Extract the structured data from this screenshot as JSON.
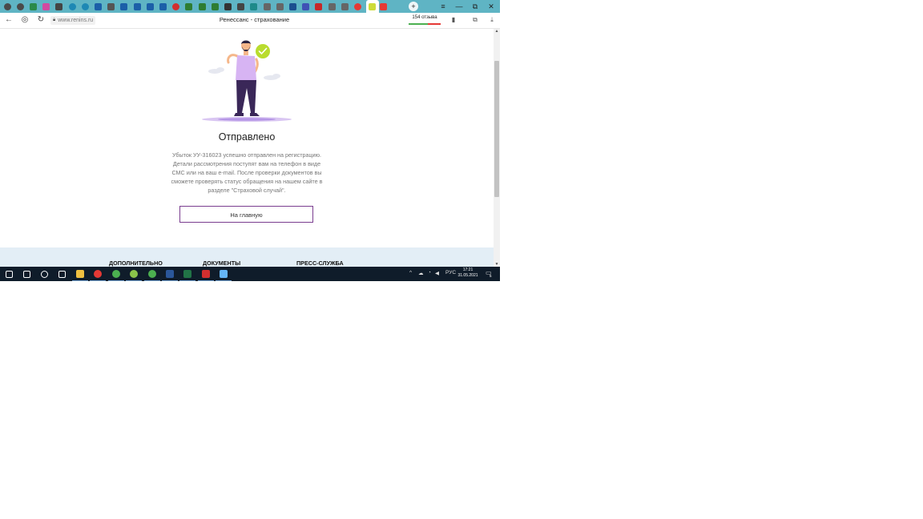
{
  "browser": {
    "url": "www.renins.ru",
    "page_title": "Ренессанс - страхование",
    "reviews_badge": "154 отзыва",
    "window_controls": {
      "menu": "≡",
      "minimize": "—",
      "restore": "⧉",
      "close": "✕"
    },
    "new_tab": "+"
  },
  "tabs": [
    {
      "icon": "opera-icon",
      "color": "#4a4a4a"
    },
    {
      "icon": "opera-icon",
      "color": "#4a4a4a"
    },
    {
      "icon": "vk-icon",
      "color": "#2a8a4a"
    },
    {
      "icon": "pinterest-icon",
      "color": "#d24aa0"
    },
    {
      "icon": "document-icon",
      "color": "#444"
    },
    {
      "icon": "circle-icon",
      "color": "#1e88b4"
    },
    {
      "icon": "circle-icon",
      "color": "#1e88b4"
    },
    {
      "icon": "monitor-icon",
      "color": "#1b5fa8"
    },
    {
      "icon": "tag-icon",
      "color": "#555"
    },
    {
      "icon": "monitor-icon",
      "color": "#1b5fa8"
    },
    {
      "icon": "x-icon",
      "color": "#1b5fa8"
    },
    {
      "icon": "m-icon",
      "color": "#1b5fa8"
    },
    {
      "icon": "outlook-icon",
      "color": "#1b5fa8"
    },
    {
      "icon": "red-dot-icon",
      "color": "#d32f2f"
    },
    {
      "icon": "table-icon",
      "color": "#2e7d32"
    },
    {
      "icon": "table-icon",
      "color": "#2e7d32"
    },
    {
      "icon": "table-icon",
      "color": "#2e7d32"
    },
    {
      "icon": "chart-icon",
      "color": "#333"
    },
    {
      "icon": "page-icon",
      "color": "#444"
    },
    {
      "icon": "v-icon",
      "color": "#1e8a8a"
    },
    {
      "icon": "gear-icon",
      "color": "#666"
    },
    {
      "icon": "gear-icon",
      "color": "#666"
    },
    {
      "icon": "chart-icon",
      "color": "#1b4f8f"
    },
    {
      "icon": "flag-icon",
      "color": "#3f51b5"
    },
    {
      "icon": "book-icon",
      "color": "#c62828"
    },
    {
      "icon": "gear-icon",
      "color": "#666"
    },
    {
      "icon": "gear-icon",
      "color": "#666"
    },
    {
      "icon": "yandex-icon",
      "color": "#e53935"
    },
    {
      "icon": "renins-icon",
      "color": "#cddc39",
      "active": true
    },
    {
      "icon": "flag-icon",
      "color": "#e53935"
    }
  ],
  "page": {
    "success_title": "Отправлено",
    "success_lines": [
      "Убыток УУ-316023 успешно отправлен на регистрацию.",
      "Детали рассмотрения поступят вам на телефон в виде",
      "СМС или на ваш e-mail. После проверки документов вы",
      "сможете проверять статус обращения на нашем сайте в",
      "разделе \"Страховой случай\"."
    ],
    "home_button": "На главную",
    "footer_links": [
      "ДОПОЛНИТЕЛЬНО",
      "ДОКУМЕНТЫ",
      "ПРЕСС-СЛУЖБА"
    ]
  },
  "taskbar": {
    "apps": [
      {
        "icon": "windows-icon",
        "color": "#ffffff"
      },
      {
        "icon": "search-icon",
        "color": "#ffffff"
      },
      {
        "icon": "cortana-icon",
        "color": "#ffffff"
      },
      {
        "icon": "task-view-icon",
        "color": "#ffffff"
      },
      {
        "icon": "folder-icon",
        "color": "#f0c040"
      },
      {
        "icon": "yandex-browser-icon",
        "color": "#e53935"
      },
      {
        "icon": "chrome-icon",
        "color": "#4caf50"
      },
      {
        "icon": "app-icon",
        "color": "#8bc34a"
      },
      {
        "icon": "app-icon",
        "color": "#4caf50"
      },
      {
        "icon": "word-icon",
        "color": "#2b579a"
      },
      {
        "icon": "excel-icon",
        "color": "#217346"
      },
      {
        "icon": "acrobat-icon",
        "color": "#d32f2f"
      },
      {
        "icon": "screen-icon",
        "color": "#64b5f6"
      }
    ],
    "language": "РУС",
    "time": "17:21",
    "date": "31.05.2021",
    "notification_count": "5"
  }
}
